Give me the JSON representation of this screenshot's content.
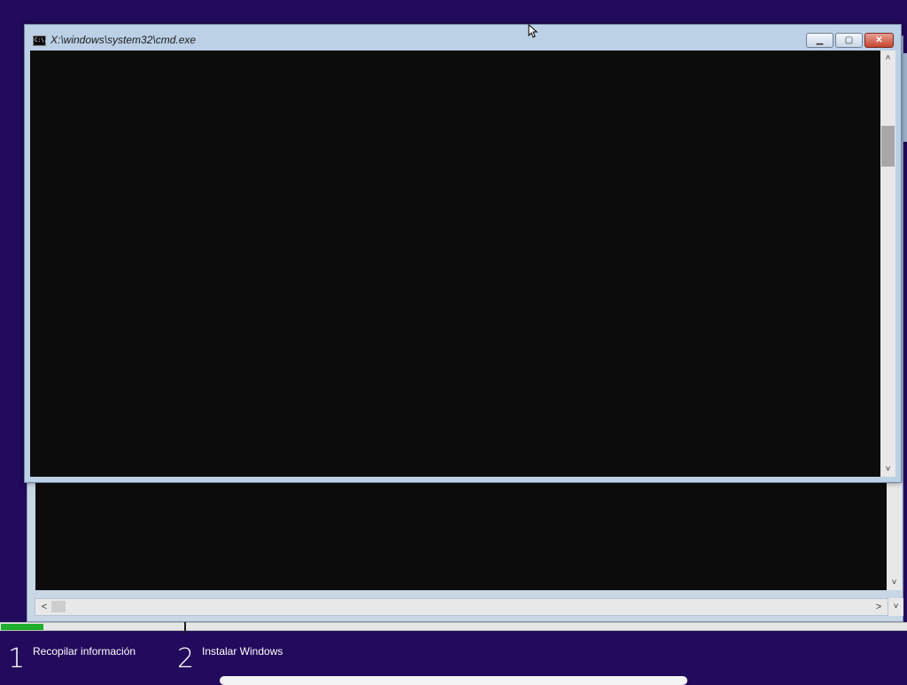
{
  "cmd_window": {
    "title": "X:\\windows\\system32\\cmd.exe",
    "icon_text": "C:\\.",
    "controls": {
      "minimize": "▁",
      "maximize": "▢",
      "close": "✕"
    }
  },
  "scroll": {
    "up": "˄",
    "down": "˅",
    "left": "<",
    "right": ">"
  },
  "setup": {
    "progress_fraction": 0.047,
    "steps": [
      {
        "number": "1",
        "label": "Recopilar información"
      },
      {
        "number": "2",
        "label": "Instalar Windows"
      }
    ]
  },
  "colors": {
    "desktop": "#220a5c",
    "console": "#0c0c0c",
    "progress": "#1fae2e"
  }
}
